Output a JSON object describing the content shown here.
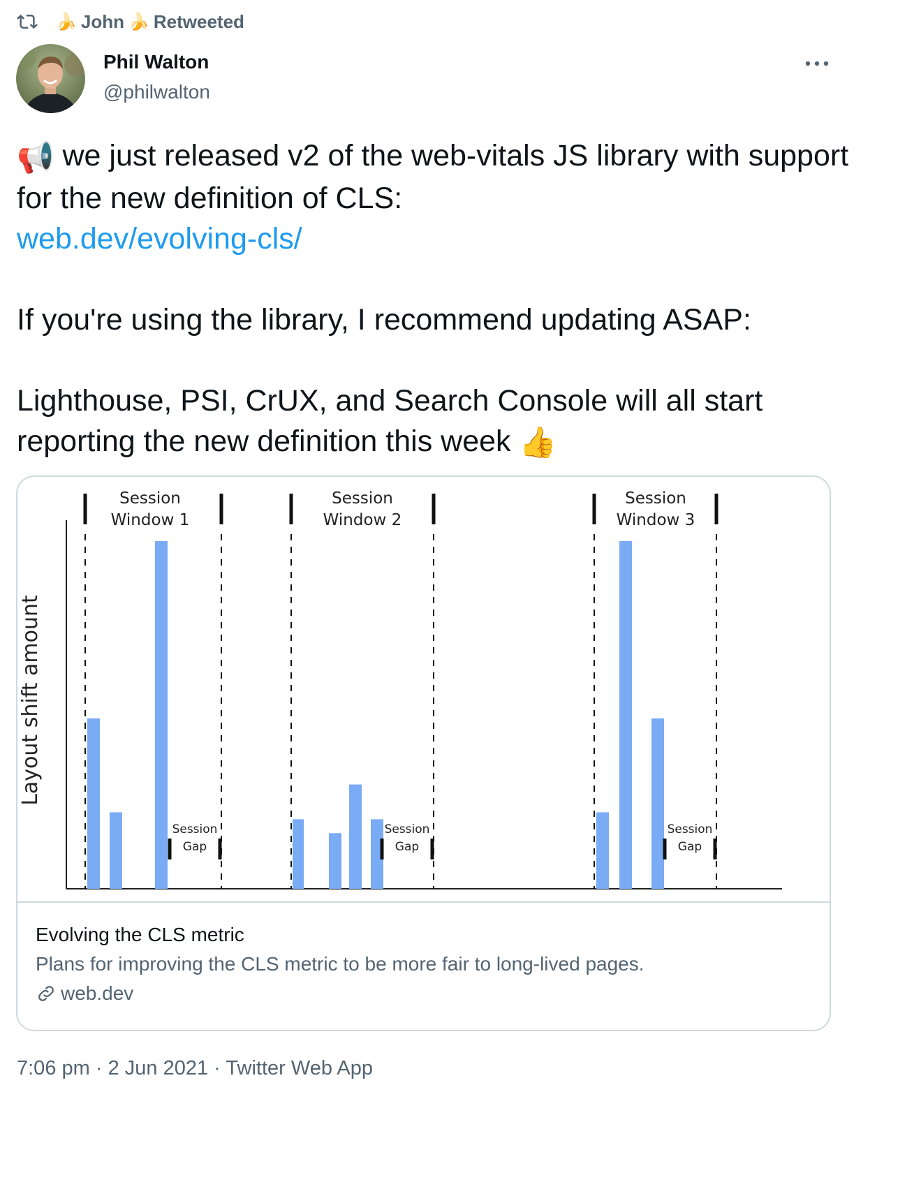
{
  "retweet": {
    "user": "John",
    "label": "Retweeted",
    "decoration": "🍌"
  },
  "author": {
    "name": "Phil Walton",
    "handle": "@philwalton"
  },
  "tweet": {
    "emoji_start": "📢",
    "line1": " we just released v2 of the web-vitals JS library with support for the new definition of CLS:",
    "link": "web.dev/evolving-cls/",
    "para2": "If you're using the library, I recommend updating ASAP:",
    "para3": "Lighthouse, PSI, CrUX, and Search Console will all start reporting the new definition this week ",
    "emoji_end": "👍"
  },
  "card": {
    "title": "Evolving the CLS metric",
    "description": "Plans for improving the CLS metric to be more fair to long-lived pages.",
    "domain": "web.dev"
  },
  "footer": {
    "time": "7:06 pm",
    "date": "2 Jun 2021",
    "source": "Twitter Web App",
    "separator": "·"
  },
  "colors": {
    "link": "#1d9bf0",
    "secondary": "#536471",
    "bar": "#7aabf5",
    "border": "#cfd9de"
  },
  "icons": {
    "retweet": "retweet-icon",
    "more": "more-icon",
    "link": "link-icon"
  },
  "chart_data": {
    "type": "bar",
    "ylabel": "Layout shift amount",
    "windows": [
      {
        "label_line1": "Session",
        "label_line2": "Window 1",
        "values": [
          0.49,
          0.22,
          1.0
        ]
      },
      {
        "label_line1": "Session",
        "label_line2": "Window 2",
        "values": [
          0.2,
          0.16,
          0.3,
          0.2
        ]
      },
      {
        "label_line1": "Session",
        "label_line2": "Window 3",
        "values": [
          0.22,
          1.0,
          0.49
        ]
      }
    ],
    "gap_label_line1": "Session",
    "gap_label_line2": "Gap",
    "ylim": [
      0,
      1
    ]
  }
}
